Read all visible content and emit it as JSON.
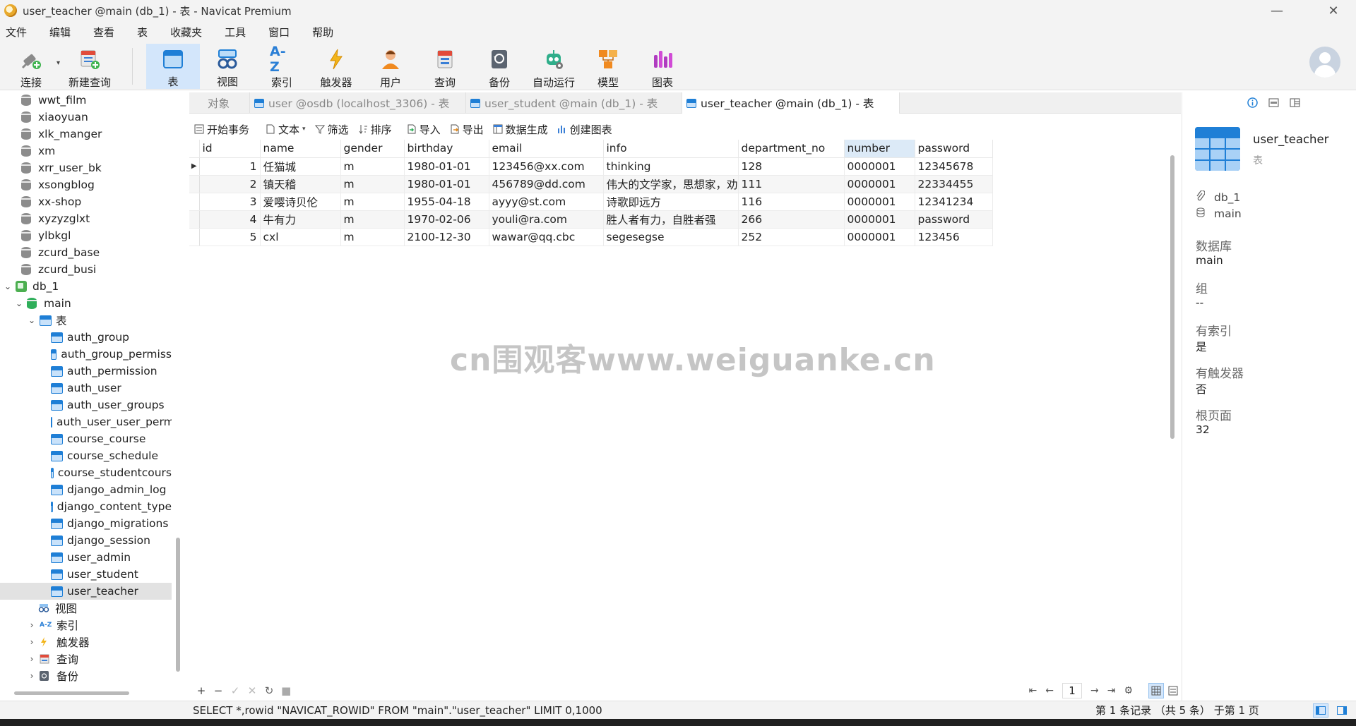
{
  "window": {
    "title": "user_teacher @main (db_1) - 表 - Navicat Premium",
    "minimize_glyph": "—",
    "restore_glyph": "❐",
    "close_glyph": "✕"
  },
  "menu": [
    "文件",
    "编辑",
    "查看",
    "表",
    "收藏夹",
    "工具",
    "窗口",
    "帮助"
  ],
  "toolbar": {
    "connect": "连接",
    "new_query": "新建查询",
    "table": "表",
    "view": "视图",
    "index": "索引",
    "trigger": "触发器",
    "user": "用户",
    "query": "查询",
    "backup": "备份",
    "automation": "自动运行",
    "model": "模型",
    "chart": "图表",
    "index_icon_text": "A-Z"
  },
  "nav": {
    "items": [
      {
        "label": "wwt_film",
        "type": "db-gray"
      },
      {
        "label": "xiaoyuan",
        "type": "db-gray"
      },
      {
        "label": "xlk_manger",
        "type": "db-gray"
      },
      {
        "label": "xm",
        "type": "db-gray"
      },
      {
        "label": "xrr_user_bk",
        "type": "db-gray"
      },
      {
        "label": "xsongblog",
        "type": "db-gray"
      },
      {
        "label": "xx-shop",
        "type": "db-gray"
      },
      {
        "label": "xyzyzglxt",
        "type": "db-gray"
      },
      {
        "label": "ylbkgl",
        "type": "db-gray"
      },
      {
        "label": "zcurd_base",
        "type": "db-gray"
      },
      {
        "label": "zcurd_busi",
        "type": "db-gray"
      },
      {
        "label": "db_1",
        "type": "connection"
      },
      {
        "label": "main",
        "type": "schema"
      },
      {
        "label": "表",
        "type": "tables-folder"
      },
      {
        "label": "auth_group",
        "type": "table"
      },
      {
        "label": "auth_group_permiss",
        "type": "table"
      },
      {
        "label": "auth_permission",
        "type": "table"
      },
      {
        "label": "auth_user",
        "type": "table"
      },
      {
        "label": "auth_user_groups",
        "type": "table"
      },
      {
        "label": "auth_user_user_perm",
        "type": "table"
      },
      {
        "label": "course_course",
        "type": "table"
      },
      {
        "label": "course_schedule",
        "type": "table"
      },
      {
        "label": "course_studentcours",
        "type": "table"
      },
      {
        "label": "django_admin_log",
        "type": "table"
      },
      {
        "label": "django_content_type",
        "type": "table"
      },
      {
        "label": "django_migrations",
        "type": "table"
      },
      {
        "label": "django_session",
        "type": "table"
      },
      {
        "label": "user_admin",
        "type": "table"
      },
      {
        "label": "user_student",
        "type": "table"
      },
      {
        "label": "user_teacher",
        "type": "table",
        "selected": true
      },
      {
        "label": "视图",
        "type": "views-folder"
      },
      {
        "label": "索引",
        "type": "indexes-folder"
      },
      {
        "label": "触发器",
        "type": "triggers-folder"
      },
      {
        "label": "查询",
        "type": "queries-folder"
      },
      {
        "label": "备份",
        "type": "backups-folder"
      }
    ]
  },
  "tabs": [
    {
      "label": "对象",
      "active": false
    },
    {
      "label": "user @osdb (localhost_3306) - 表",
      "active": false
    },
    {
      "label": "user_student @main (db_1) - 表",
      "active": false
    },
    {
      "label": "user_teacher @main (db_1) - 表",
      "active": true
    }
  ],
  "objbar": {
    "begin_transaction": "开始事务",
    "text": "文本",
    "filter": "筛选",
    "sort": "排序",
    "import": "导入",
    "export": "导出",
    "data_generation": "数据生成",
    "create_chart": "创建图表"
  },
  "grid": {
    "columns": [
      "id",
      "name",
      "gender",
      "birthday",
      "email",
      "info",
      "department_no",
      "number",
      "password"
    ],
    "rows": [
      [
        "1",
        "任猫城",
        "m",
        "1980-01-01",
        "123456@xx.com",
        "thinking",
        "128",
        "0000001",
        "12345678"
      ],
      [
        "2",
        "镇天稽",
        "m",
        "1980-01-01",
        "456789@dd.com",
        "伟大的文学家，思想家，劝",
        "111",
        "0000001",
        "22334455"
      ],
      [
        "3",
        "爱嘤诗贝伦",
        "m",
        "1955-04-18",
        "ayyy@st.com",
        "诗歌即远方",
        "116",
        "0000001",
        "12341234"
      ],
      [
        "4",
        "牛有力",
        "m",
        "1970-02-06",
        "youli@ra.com",
        "胜人者有力，自胜者强",
        "266",
        "0000001",
        "password"
      ],
      [
        "5",
        "cxl",
        "m",
        "2100-12-30",
        "wawar@qq.cbc",
        "segesegse",
        "252",
        "0000001",
        "123456"
      ]
    ]
  },
  "watermark": "cn围观客www.weiguanke.cn",
  "pager": {
    "page": "1"
  },
  "status": {
    "sql": "SELECT *,rowid \"NAVICAT_ROWID\" FROM \"main\".\"user_teacher\" LIMIT 0,1000",
    "records": "第 1 条记录 （共 5 条） 于第 1 页"
  },
  "info_panel": {
    "name": "user_teacher",
    "type": "表",
    "connection": "db_1",
    "schema": "main",
    "fields": [
      {
        "label": "数据库",
        "value": "main"
      },
      {
        "label": "组",
        "value": "--"
      },
      {
        "label": "有索引",
        "value": "是"
      },
      {
        "label": "有触发器",
        "value": "否"
      },
      {
        "label": "根页面",
        "value": "32"
      }
    ]
  }
}
